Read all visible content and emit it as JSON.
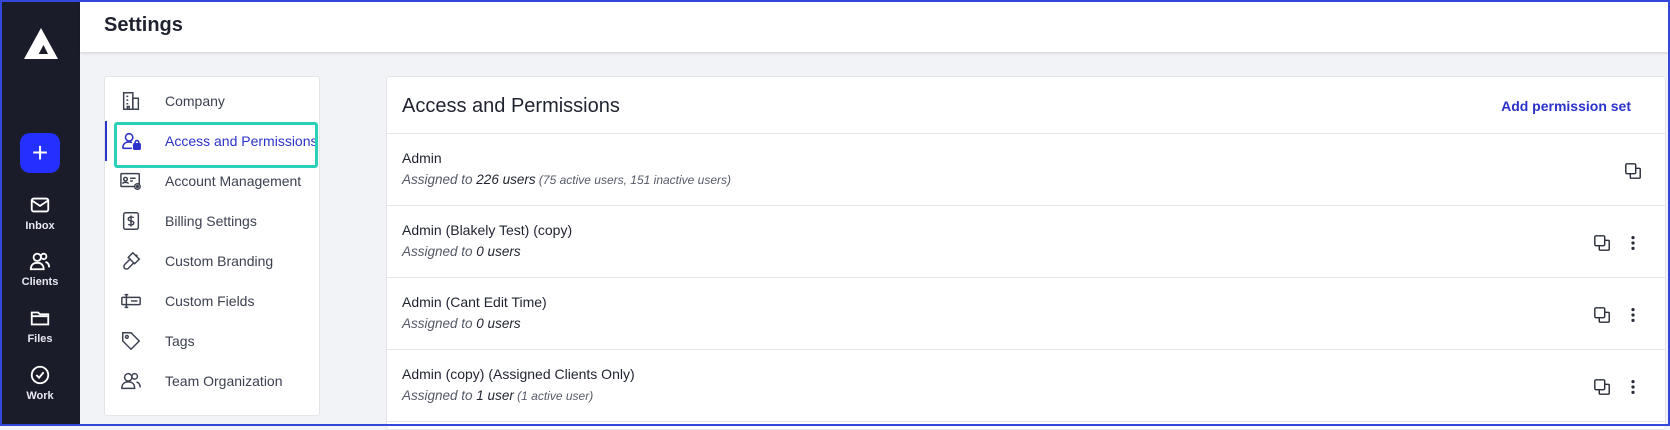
{
  "app": {
    "page_title": "Settings",
    "colors": {
      "accent": "#2b32c9",
      "primary_button": "#2330ff",
      "rail": "#1b1c2a",
      "highlight": "#2bd0bb"
    }
  },
  "rail": {
    "new_icon": "plus-icon",
    "items": [
      {
        "label": "Inbox",
        "icon": "mail-icon"
      },
      {
        "label": "Clients",
        "icon": "users-icon"
      },
      {
        "label": "Files",
        "icon": "folder-icon"
      },
      {
        "label": "Work",
        "icon": "check-circle-icon"
      }
    ]
  },
  "menu": {
    "items": [
      {
        "label": "Company",
        "icon": "building-icon"
      },
      {
        "label": "Access and Permissions",
        "icon": "user-lock-icon",
        "active": true
      },
      {
        "label": "Account Management",
        "icon": "id-card-gear-icon"
      },
      {
        "label": "Billing Settings",
        "icon": "dollar-icon"
      },
      {
        "label": "Custom Branding",
        "icon": "brush-icon"
      },
      {
        "label": "Custom Fields",
        "icon": "text-field-icon"
      },
      {
        "label": "Tags",
        "icon": "tag-icon"
      },
      {
        "label": "Team Organization",
        "icon": "team-icon"
      }
    ]
  },
  "main": {
    "title": "Access and Permissions",
    "add_label": "Add permission set",
    "rows": [
      {
        "name": "Admin",
        "prefix": "Assigned to ",
        "count": "226 users",
        "detail": " (75 active users, 151 inactive users)",
        "has_menu": false
      },
      {
        "name": "Admin (Blakely Test) (copy)",
        "prefix": "Assigned to ",
        "count": "0 users",
        "detail": "",
        "has_menu": true
      },
      {
        "name": "Admin (Cant Edit Time)",
        "prefix": "Assigned to ",
        "count": "0 users",
        "detail": "",
        "has_menu": true
      },
      {
        "name": "Admin (copy) (Assigned Clients Only)",
        "prefix": "Assigned to ",
        "count": "1 user",
        "detail": " (1 active user)",
        "has_menu": true
      }
    ]
  }
}
